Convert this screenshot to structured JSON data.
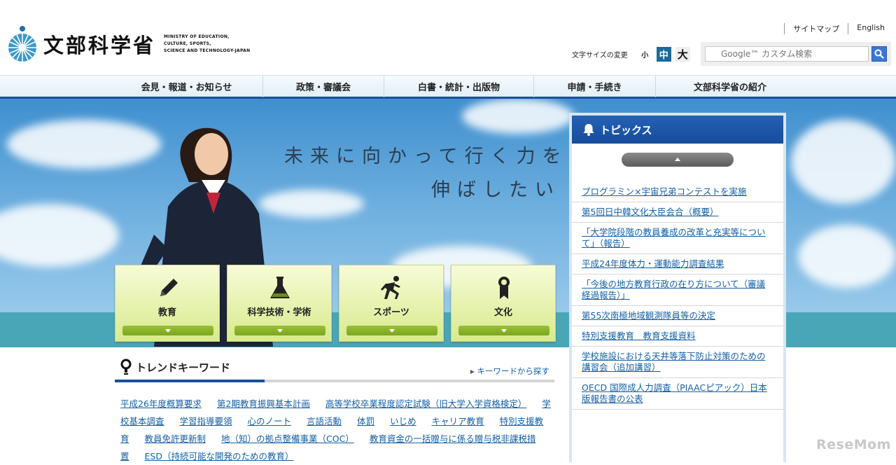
{
  "header": {
    "logo_title": "文部科学省",
    "logo_en_lines": [
      "MINISTRY OF EDUCATION,",
      "CULTURE, SPORTS,",
      "SCIENCE AND TECHNOLOGY-JAPAN"
    ],
    "util_links": [
      "サイトマップ",
      "English"
    ],
    "fontsize": {
      "label": "文字サイズの変更",
      "small": "小",
      "medium": "中",
      "large": "大",
      "selected": "中"
    },
    "search": {
      "placeholder": "Google™ カスタム検索"
    }
  },
  "gnav": {
    "items": [
      "会見・報道・お知らせ",
      "政策・審議会",
      "白書・統計・出版物",
      "申請・手続き",
      "文部科学省の紹介"
    ]
  },
  "hero": {
    "catch_line1": "未来に向かって行く力を",
    "catch_line2": "伸ばしたい",
    "categories": [
      {
        "label": "教育",
        "icon": "pencil-icon"
      },
      {
        "label": "科学技術・学術",
        "icon": "flask-icon"
      },
      {
        "label": "スポーツ",
        "icon": "runner-icon"
      },
      {
        "label": "文化",
        "icon": "award-ribbon-icon"
      }
    ]
  },
  "topics": {
    "title": "トピックス",
    "items": [
      "プログラミン×宇宙兄弟コンテストを実施",
      "第5回日中韓文化大臣会合（概要）",
      "「大学院段階の教員養成の改革と充実等について」（報告）",
      "平成24年度体力・運動能力調査結果",
      "「今後の地方教育行政の在り方について（審議経過報告）」",
      "第55次南極地域観測隊員等の決定",
      "特別支援教育　教育支援資料",
      "学校施設における天井等落下防止対策のための講習会（追加講習）",
      "OECD 国際成人力調査（PIAACピアック）日本版報告書の公表"
    ]
  },
  "trend": {
    "title": "トレンドキーワード",
    "more_link": "キーワードから探す",
    "keywords": [
      "平成26年度概算要求",
      "第2期教育振興基本計画",
      "高等学校卒業程度認定試験（旧大学入学資格検定）",
      "学校基本調査",
      "学習指導要領",
      "心のノート",
      "言語活動",
      "体罰",
      "いじめ",
      "キャリア教育",
      "特別支援教育",
      "教員免許更新制",
      "地（知）の拠点整備事業（COC）",
      "教育資金の一括贈与に係る贈与税非課税措置",
      "ESD（持続可能な開発のための教育）"
    ]
  },
  "watermark": "ReseMom",
  "colors": {
    "nav_accent": "#1a4f9a",
    "link": "#1560a6",
    "tile_green": "#d7eb8b",
    "topics_header": "#2461b4"
  }
}
